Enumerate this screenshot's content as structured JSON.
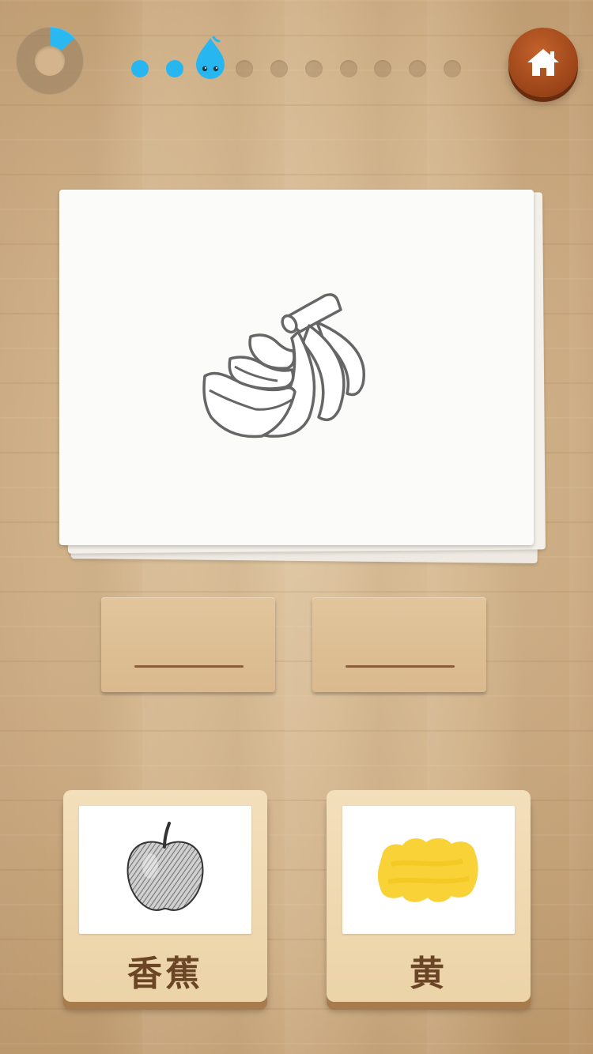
{
  "header": {
    "timer": {
      "remaining_fraction": 0.13,
      "accent_color": "#29b8f0"
    },
    "progress": {
      "total_steps": 11,
      "current_step": 3
    },
    "home_icon": "home-icon"
  },
  "picture_card": {
    "icon": "banana-bunch-drawing"
  },
  "answer_slots": [
    "",
    ""
  ],
  "choices": [
    {
      "image": "apple-sketch",
      "label": "香蕉"
    },
    {
      "image": "yellow-paint-swatch",
      "label": "黄"
    }
  ]
}
